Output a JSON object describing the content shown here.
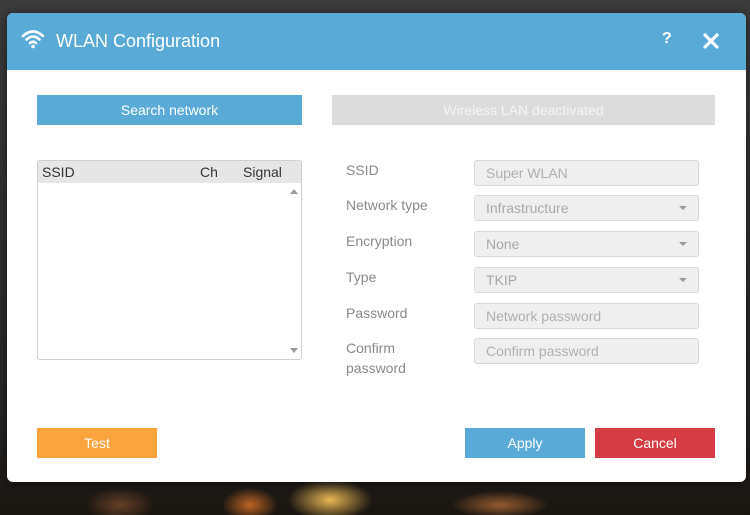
{
  "window": {
    "title": "WLAN Configuration",
    "help_label": "?",
    "icon": "wifi-icon",
    "close_icon": "close-icon"
  },
  "actions": {
    "search_network": "Search network",
    "wlan_status": "Wireless LAN deactivated"
  },
  "network_list": {
    "columns": [
      "SSID",
      "Ch",
      "Signal"
    ],
    "rows": []
  },
  "form": {
    "ssid": {
      "label": "SSID",
      "placeholder": "Super WLAN"
    },
    "network_type": {
      "label": "Network type",
      "value": "Infrastructure"
    },
    "encryption": {
      "label": "Encryption",
      "value": "None"
    },
    "type": {
      "label": "Type",
      "value": "TKIP"
    },
    "password": {
      "label": "Password",
      "placeholder": "Network password"
    },
    "confirm_password": {
      "label_line1": "Confirm",
      "label_line2": "password",
      "placeholder": "Confirm password"
    }
  },
  "footer": {
    "test": "Test",
    "apply": "Apply",
    "cancel": "Cancel"
  },
  "colors": {
    "accent": "#5aaad8",
    "test": "#fba33c",
    "cancel": "#d63c44"
  }
}
